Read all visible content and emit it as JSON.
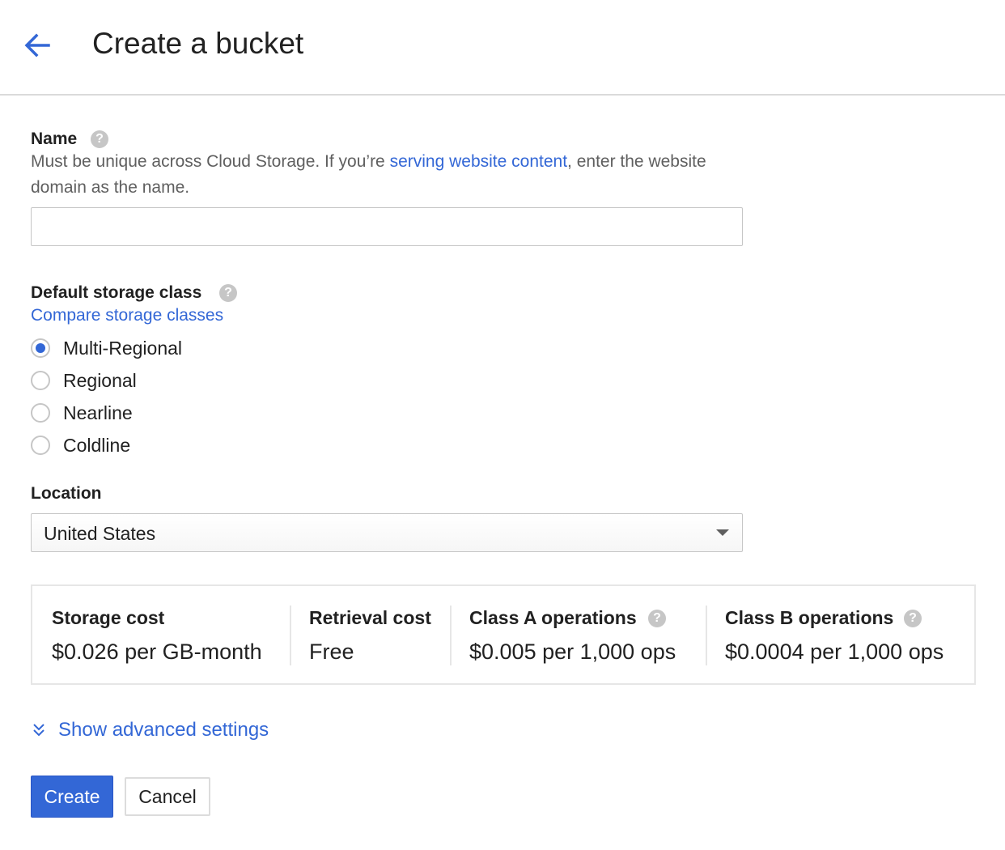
{
  "header": {
    "title": "Create a bucket",
    "back_icon": "arrow-back-icon"
  },
  "name_section": {
    "label": "Name",
    "help_glyph": "?",
    "description_before": "Must be unique across Cloud Storage. If you’re ",
    "description_link": "serving website content",
    "description_after": ", enter the website domain as the name.",
    "input_value": "",
    "input_placeholder": ""
  },
  "storage_class": {
    "label": "Default storage class",
    "help_glyph": "?",
    "compare_link": "Compare storage classes",
    "options": [
      {
        "label": "Multi-Regional",
        "selected": true
      },
      {
        "label": "Regional",
        "selected": false
      },
      {
        "label": "Nearline",
        "selected": false
      },
      {
        "label": "Coldline",
        "selected": false
      }
    ]
  },
  "location": {
    "label": "Location",
    "selected": "United States"
  },
  "costs": [
    {
      "title": "Storage cost",
      "value": "$0.026 per GB-month",
      "help": false
    },
    {
      "title": "Retrieval cost",
      "value": "Free",
      "help": false
    },
    {
      "title": "Class A operations",
      "value": "$0.005 per 1,000 ops",
      "help": true
    },
    {
      "title": "Class B operations",
      "value": "$0.0004 per 1,000 ops",
      "help": true
    }
  ],
  "advanced": {
    "label": "Show advanced settings",
    "icon": "double-chevron-down-icon"
  },
  "actions": {
    "create": "Create",
    "cancel": "Cancel"
  },
  "colors": {
    "accent": "#3367d6",
    "help_icon": "#c6c6c6"
  }
}
